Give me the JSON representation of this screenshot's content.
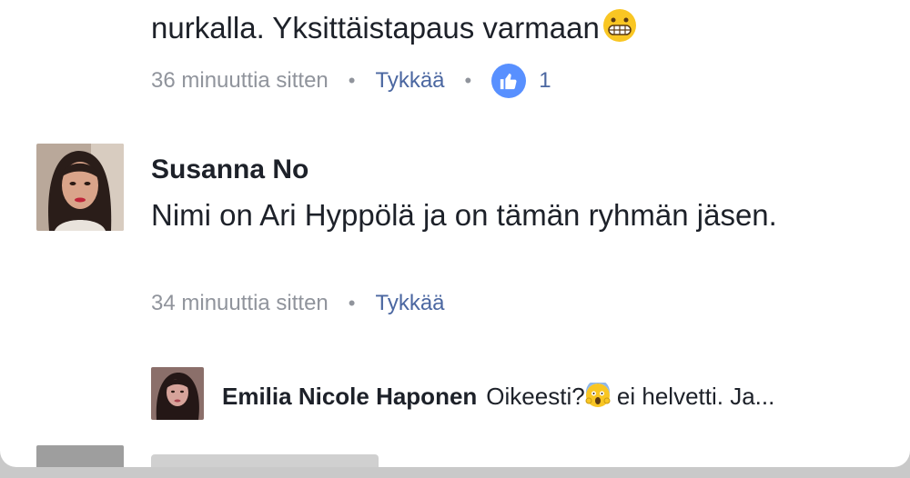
{
  "comment_prev": {
    "text": "nurkalla. Yksittäistapaus varmaan",
    "emoji": "grimacing-face",
    "time": "36 minuuttia sitten",
    "like_label": "Tykkää",
    "reaction_icon": "thumbs-up-icon",
    "reaction_count": "1"
  },
  "comment_main": {
    "author": "Susanna No",
    "text": "Nimi on Ari Hyppölä ja on tämän ryhmän jäsen.",
    "time": "34 minuuttia sitten",
    "like_label": "Tykkää"
  },
  "reply": {
    "author": "Emilia Nicole Haponen",
    "text_before_emoji": "Oikeesti?",
    "emoji": "face-screaming-in-fear",
    "text_after_emoji": " ei helvetti. Ja..."
  },
  "separator": "•",
  "colors": {
    "text": "#1d2129",
    "meta_gray": "#90949c",
    "link_blue": "#4b67a1",
    "like_badge": "#5890ff"
  }
}
